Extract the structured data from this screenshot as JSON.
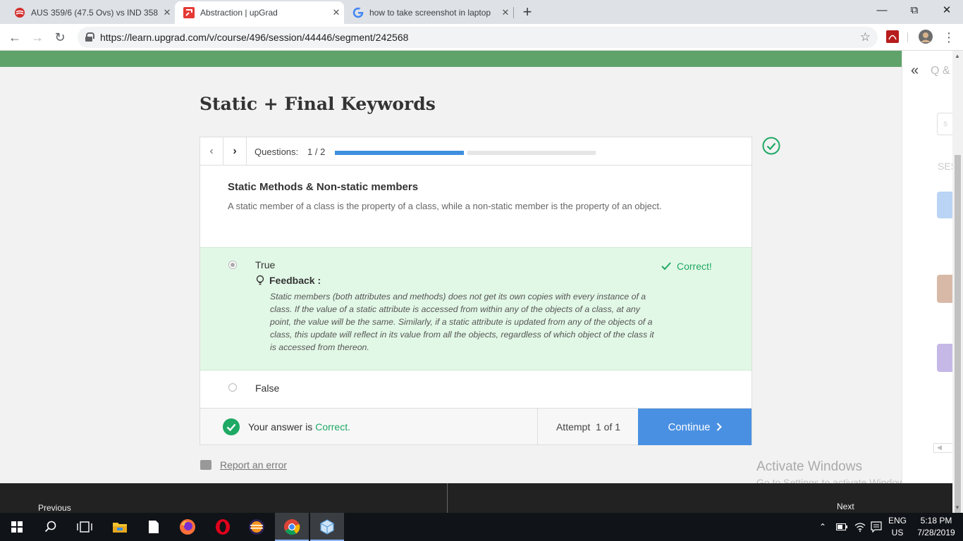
{
  "browser": {
    "tabs": [
      {
        "title": "AUS 359/6 (47.5 Ovs) vs IND 358",
        "active": false
      },
      {
        "title": "Abstraction | upGrad",
        "active": true
      },
      {
        "title": "how to take screenshot in laptop",
        "active": false
      }
    ],
    "url": "https://learn.upgrad.com/v/course/496/session/44446/segment/242568"
  },
  "page": {
    "title": "Static + Final Keywords",
    "questions_label": "Questions:",
    "question_count": "1 / 2",
    "progress": 0.5,
    "question": {
      "title": "Static Methods & Non-static members",
      "text": "A static member of a class is the property of a class, while a non-static member is the property of an object."
    },
    "options": [
      {
        "label": "True",
        "selected": true
      },
      {
        "label": "False",
        "selected": false
      }
    ],
    "correct_tag": "Correct!",
    "feedback_label": "Feedback :",
    "feedback_text": "Static members (both attributes and methods) does not get its own copies with every instance of a class. If the value of a static attribute is accessed from within any of the objects of a class, at any point, the value will be the same. Similarly, if a static attribute is updated from any of the objects of a class, this update will reflect in its value from all the objects, regardless of which object of the class it is accessed from thereon.",
    "answer_prefix": "Your answer is",
    "answer_status": "Correct.",
    "attempt_label": "Attempt",
    "attempt_value": "1 of 1",
    "continue_label": "Continue",
    "report_label": "Report an error",
    "prev_label": "Previous",
    "next_label": "Next"
  },
  "side_panel": {
    "qa_label": "Q &",
    "search_placeholder": "S",
    "sessions_label": "SES"
  },
  "watermark": {
    "line1": "Activate Windows",
    "line2": "Go to Settings to activate Windows."
  },
  "taskbar": {
    "lang_line1": "ENG",
    "lang_line2": "US",
    "time": "5:18 PM",
    "date": "7/28/2019"
  },
  "colors": {
    "accent_green": "#5fa36a",
    "correct_green": "#1ea964",
    "button_blue": "#4a90e2"
  }
}
